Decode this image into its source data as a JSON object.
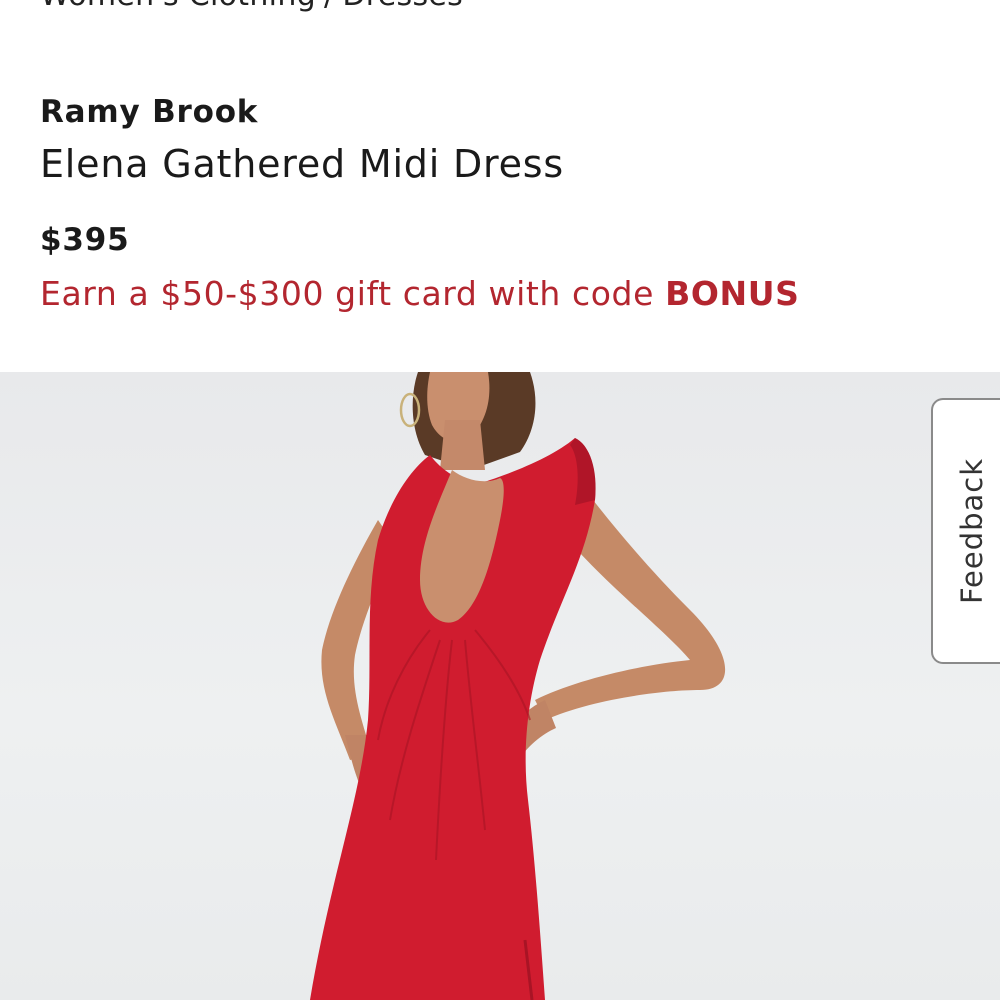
{
  "breadcrumb": {
    "items": [
      "Women's Clothing",
      "Dresses"
    ],
    "separator": "/"
  },
  "product": {
    "brand": "Ramy Brook",
    "name": "Elena Gathered Midi Dress",
    "price": "$395",
    "promo_text": "Earn a $50-$300 gift card with code",
    "promo_code": "BONUS",
    "image_alt": "Model wearing red Elena Gathered Midi Dress"
  },
  "feedback": {
    "label": "Feedback"
  },
  "colors": {
    "promo": "#b3262f",
    "dress": "#d01c2f",
    "background": "#eceeef"
  }
}
